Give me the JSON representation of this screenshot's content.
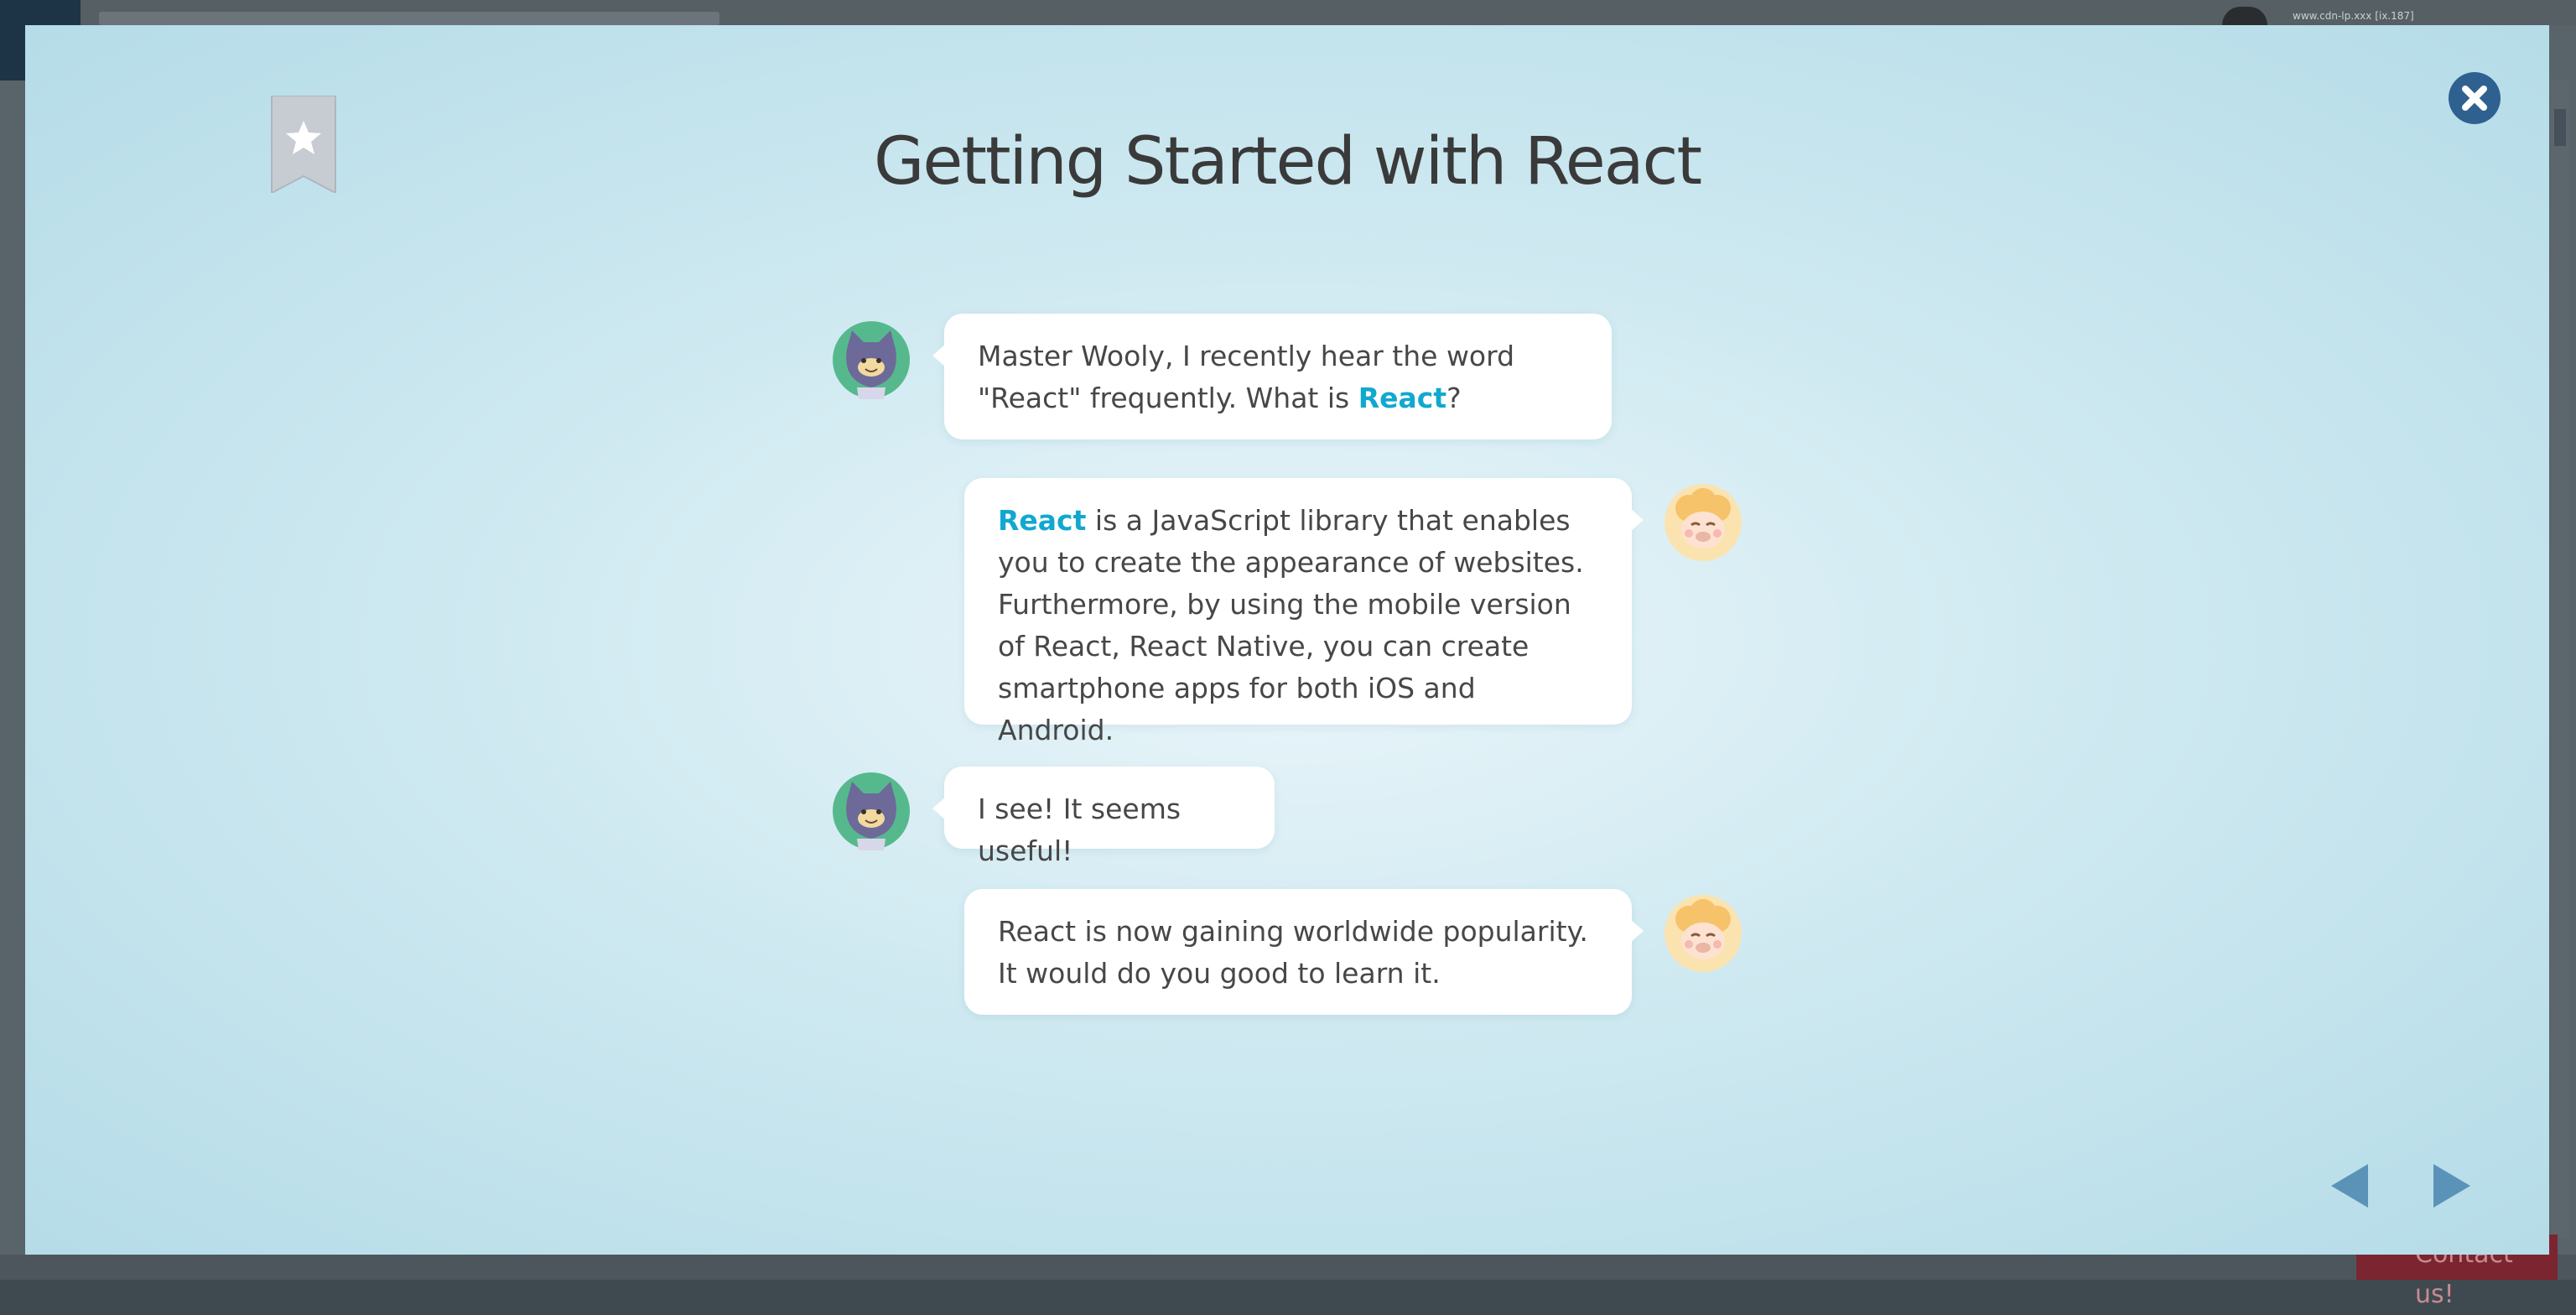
{
  "background": {
    "url_text": "www.cdn-lp.xxx [ix.187]",
    "contact_label": "Contact us!"
  },
  "modal": {
    "title": "Getting Started with React",
    "close_icon": "close-icon",
    "bookmark_icon": "bookmark-star-icon"
  },
  "conversation": [
    {
      "speaker": "student",
      "avatar": "cat-avatar",
      "parts": [
        "Master Wooly, I recently hear the word \"React\" frequently. What is ",
        "React",
        "?"
      ]
    },
    {
      "speaker": "wooly",
      "avatar": "sheep-avatar",
      "parts": [
        "React",
        " is a JavaScript library that enables you to create the appearance of websites. Furthermore, by using the mobile version of React, React Native, you can create smartphone apps for both iOS and Android."
      ]
    },
    {
      "speaker": "student",
      "avatar": "cat-avatar",
      "text": "I see! It seems useful!"
    },
    {
      "speaker": "wooly",
      "avatar": "sheep-avatar",
      "text": "React is now gaining worldwide popularity. It would do you good to learn it."
    }
  ],
  "navigation": {
    "prev_icon": "prev-arrow-icon",
    "next_icon": "next-arrow-icon"
  },
  "colors": {
    "keyword": "#11a8cf",
    "close_button": "#2e6190",
    "nav_arrow": "#5b93b8",
    "bookmark": "#c7ccd3"
  }
}
